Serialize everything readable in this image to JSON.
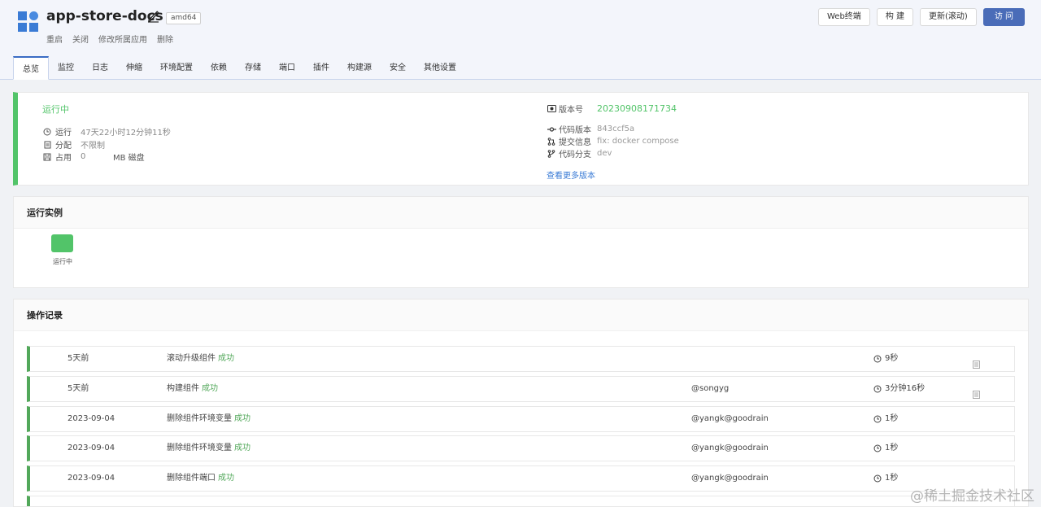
{
  "app": {
    "name": "app-store-docs",
    "arch": "amd64"
  },
  "sub_actions": [
    "重启",
    "关闭",
    "修改所属应用",
    "删除"
  ],
  "top_buttons": {
    "web_terminal": "Web终端",
    "build": "构 建",
    "update": "更新(滚动)",
    "visit": "访 问"
  },
  "tabs": [
    "总览",
    "监控",
    "日志",
    "伸缩",
    "环境配置",
    "依赖",
    "存储",
    "端口",
    "插件",
    "构建源",
    "安全",
    "其他设置"
  ],
  "status": {
    "state": "运行中",
    "run_label": "运行",
    "run_value": "47天22小时12分钟11秒",
    "alloc_label": "分配",
    "alloc_value": "不限制",
    "disk_label": "占用",
    "disk_value": "0",
    "disk_unit": "MB 磁盘"
  },
  "version": {
    "label": "版本号",
    "value": "20230908171734",
    "code_version_label": "代码版本",
    "code_version": "843ccf5a",
    "commit_label": "提交信息",
    "commit_msg": "fix: docker compose",
    "branch_label": "代码分支",
    "branch": "dev",
    "more_link": "查看更多版本"
  },
  "instances": {
    "title": "运行实例",
    "pods": [
      {
        "status": "运行中",
        "color": "#52c469"
      }
    ]
  },
  "operations": {
    "title": "操作记录",
    "rows": [
      {
        "time": "5天前",
        "desc": "滚动升级组件",
        "result": "成功",
        "user": "",
        "duration": "9秒",
        "has_log": true
      },
      {
        "time": "5天前",
        "desc": "构建组件",
        "result": "成功",
        "user": "@songyg",
        "duration": "3分钟16秒",
        "has_log": true
      },
      {
        "time": "2023-09-04",
        "desc": "删除组件环境变量",
        "result": "成功",
        "user": "@yangk@goodrain",
        "duration": "1秒",
        "has_log": false
      },
      {
        "time": "2023-09-04",
        "desc": "删除组件环境变量",
        "result": "成功",
        "user": "@yangk@goodrain",
        "duration": "1秒",
        "has_log": false
      },
      {
        "time": "2023-09-04",
        "desc": "删除组件端口",
        "result": "成功",
        "user": "@yangk@goodrain",
        "duration": "1秒",
        "has_log": false
      }
    ]
  },
  "watermark": "@稀土掘金技术社区",
  "colors": {
    "accent": "#3a6cc4",
    "success": "#52c469",
    "primary_button": "#4a6cb8"
  }
}
